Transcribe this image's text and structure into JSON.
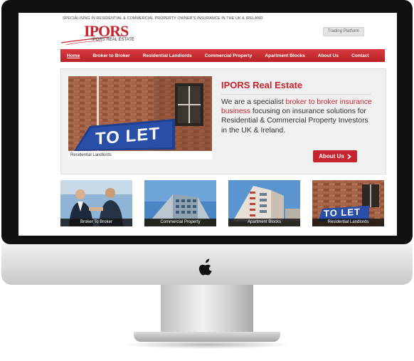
{
  "site": {
    "tagline": "SPECIALISING IN RESIDENTIAL & COMMERCIAL PROPERTY OWNER'S INSURANCE IN THE UK & IRELAND",
    "logo_name": "IPORS",
    "logo_sub": "IPORS REAL ESTATE",
    "trading_platform": "Trading Platform"
  },
  "nav": {
    "items": [
      {
        "label": "Home"
      },
      {
        "label": "Broker to Broker"
      },
      {
        "label": "Residential Landlords"
      },
      {
        "label": "Commercial Property"
      },
      {
        "label": "Apartment Blocks"
      },
      {
        "label": "About Us"
      },
      {
        "label": "Contact"
      }
    ]
  },
  "hero": {
    "image_sign": "TO LET",
    "caption": "Residential Landlords",
    "title": "IPORS Real Estate",
    "text_before": "We are a specialist ",
    "text_highlight": "broker to broker insurance business",
    "text_after": " focusing on insurance solutions for Residential & Commercial Property Investors in the UK & Ireland.",
    "button": "About Us",
    "button_icon": "chevron-right-icon"
  },
  "thumbnails": [
    {
      "label": "Broker To Broker"
    },
    {
      "label": "Commercial Property"
    },
    {
      "label": "Apartment Blocks"
    },
    {
      "label": "Residential Landlords",
      "sign": "TO LET"
    }
  ],
  "colors": {
    "brand_red": "#c5262d",
    "nav_red": "#d63a3f",
    "screen_bezel": "#101010"
  }
}
